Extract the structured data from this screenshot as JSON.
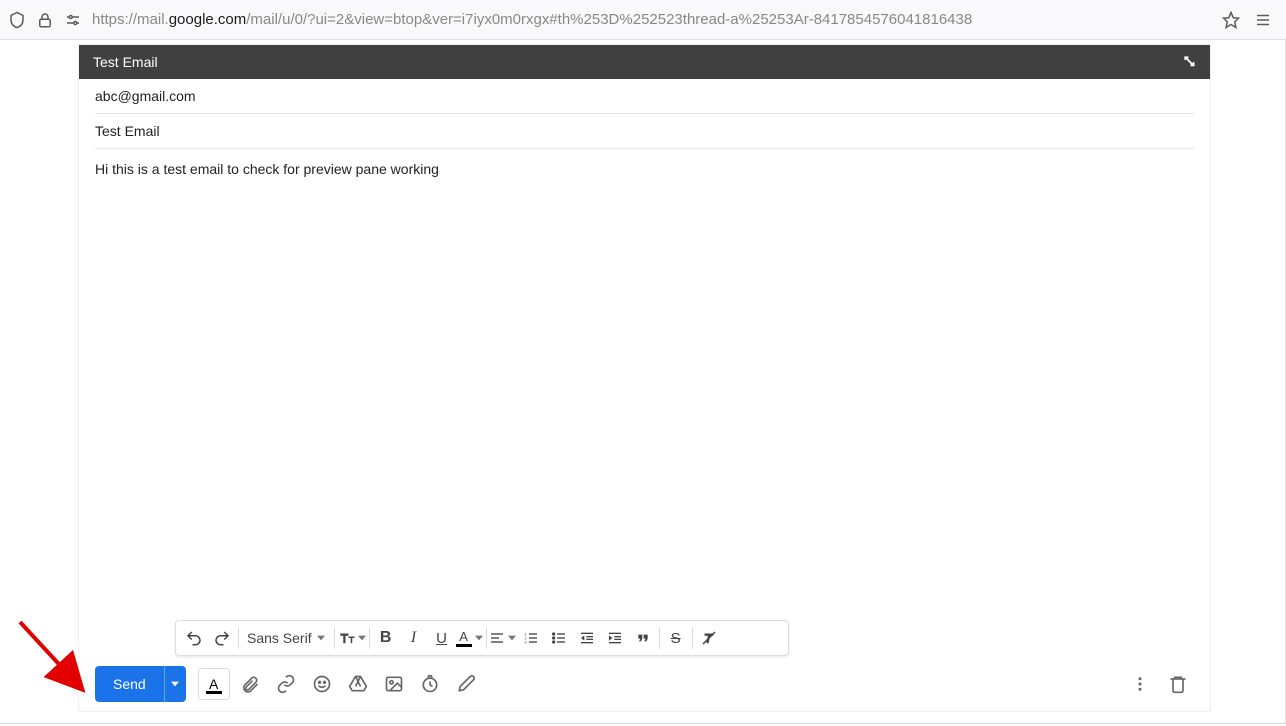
{
  "browser": {
    "url_prefix": "https://mail.",
    "url_domain": "google.com",
    "url_path": "/mail/u/0/?ui=2&view=btop&ver=i7iyx0m0rxgx#th%253D%252523thread-a%25253Ar-8417854576041816438"
  },
  "compose": {
    "title": "Test Email",
    "to": "abc@gmail.com",
    "subject": "Test Email",
    "body": "Hi this is a test email to check for preview pane working",
    "send_label": "Send"
  },
  "format": {
    "font": "Sans Serif"
  }
}
